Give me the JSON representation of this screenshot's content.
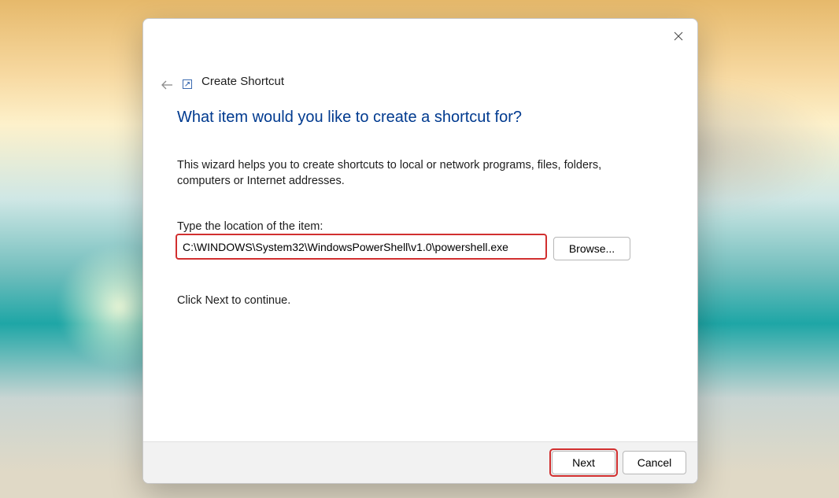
{
  "window": {
    "title": "Create Shortcut"
  },
  "wizard": {
    "heading": "What item would you like to create a shortcut for?",
    "description": "This wizard helps you to create shortcuts to local or network programs, files, folders, computers or Internet addresses.",
    "location_label": "Type the location of the item:",
    "location_value": "C:\\WINDOWS\\System32\\WindowsPowerShell\\v1.0\\powershell.exe",
    "browse_label": "Browse...",
    "continue_text": "Click Next to continue."
  },
  "footer": {
    "next_label": "Next",
    "cancel_label": "Cancel"
  }
}
